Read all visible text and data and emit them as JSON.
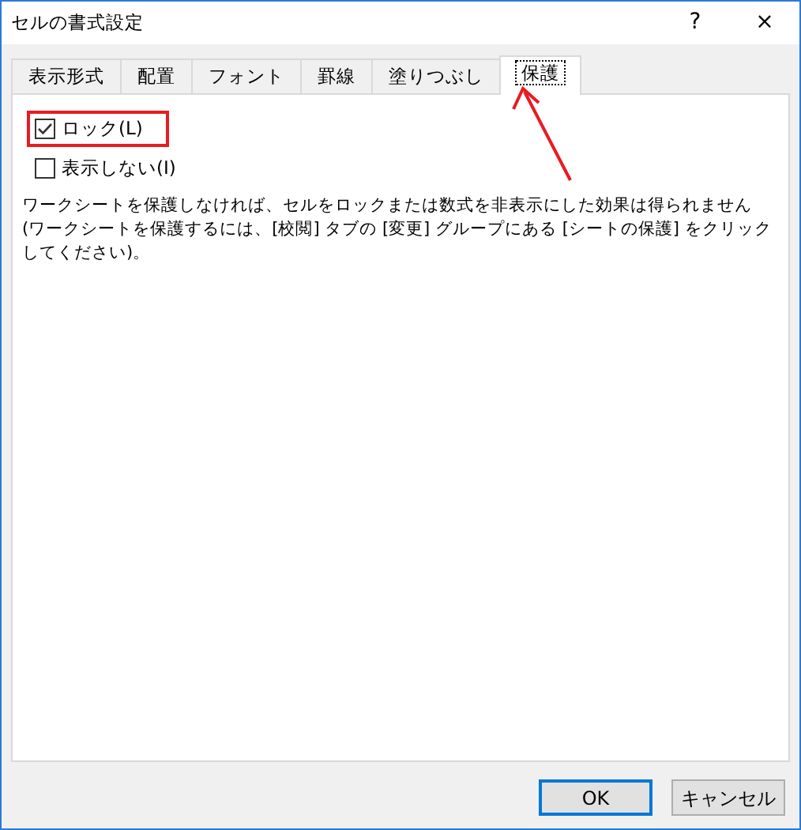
{
  "window": {
    "title": "セルの書式設定",
    "help": "?",
    "close": "×"
  },
  "tabs": [
    {
      "label": "表示形式",
      "selected": false
    },
    {
      "label": "配置",
      "selected": false
    },
    {
      "label": "フォント",
      "selected": false
    },
    {
      "label": "罫線",
      "selected": false
    },
    {
      "label": "塗りつぶし",
      "selected": false
    },
    {
      "label": "保護",
      "selected": true
    }
  ],
  "options": [
    {
      "label": "ロック(L)",
      "checked": true,
      "highlighted": true
    },
    {
      "label": "表示しない(I)",
      "checked": false,
      "highlighted": false
    }
  ],
  "description": "ワークシートを保護しなければ、セルをロックまたは数式を非表示にした効果は得られません (ワークシートを保護するには、[校閲] タブの [変更] グループにある [シートの保護] をクリックしてください)。",
  "annotation_arrow": true,
  "buttons": [
    {
      "label": "OK",
      "default": true
    },
    {
      "label": "キャンセル",
      "default": false
    }
  ]
}
